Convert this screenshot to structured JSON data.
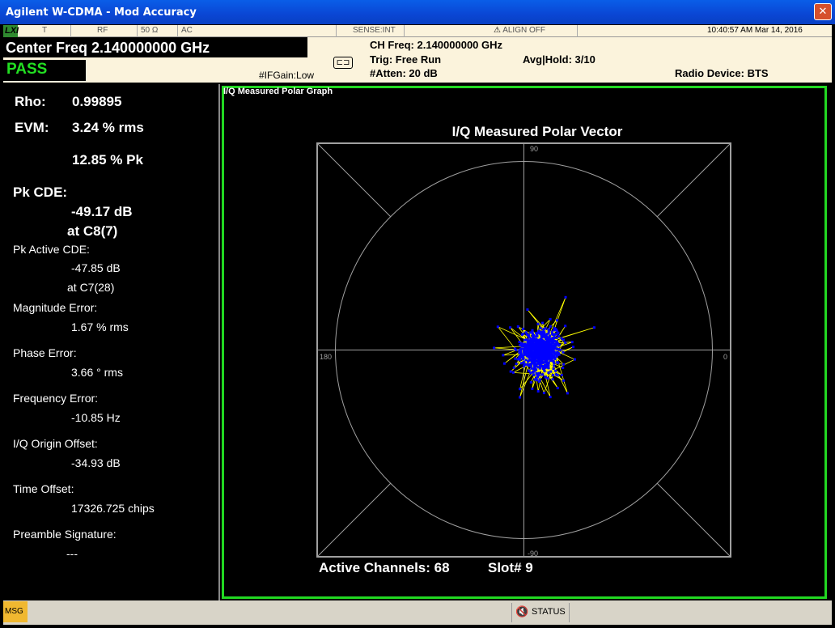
{
  "window": {
    "title": "Agilent W-CDMA - Mod Accuracy",
    "close_glyph": "✕"
  },
  "status_row": {
    "lxi": "LXI",
    "trigger": "T",
    "rf": "RF",
    "impedance": "50 Ω",
    "coupling": "AC",
    "sense": "SENSE:INT",
    "align": "ALIGN OFF",
    "datetime": "10:40:57 AM Mar 14, 2016"
  },
  "header": {
    "center_freq": "Center Freq 2.140000000 GHz",
    "pass_label": "PASS",
    "ifgain": "#IFGain:Low",
    "ch_freq": "CH Freq: 2.140000000 GHz",
    "trig": "Trig: Free Run",
    "atten": "#Atten: 20 dB",
    "avg_hold": "Avg|Hold: 3/10",
    "radio_device": "Radio Device: BTS"
  },
  "results": {
    "rho_label": "Rho:",
    "rho_value": "0.99895",
    "evm_label": "EVM:",
    "evm_rms": "3.24 % rms",
    "evm_pk": "12.85 % Pk",
    "pk_cde_label": "Pk CDE:",
    "pk_cde_value": "-49.17 dB",
    "pk_cde_at": "at C8(7)",
    "pk_active_cde_label": "Pk Active CDE:",
    "pk_active_cde_value": "-47.85 dB",
    "pk_active_cde_at": "at C7(28)",
    "mag_err_label": "Magnitude Error:",
    "mag_err_value": "1.67 % rms",
    "phase_err_label": "Phase Error:",
    "phase_err_value": "3.66 ° rms",
    "freq_err_label": "Frequency Error:",
    "freq_err_value": "-10.85 Hz",
    "iq_origin_label": "I/Q Origin Offset:",
    "iq_origin_value": "-34.93 dB",
    "time_offset_label": "Time Offset:",
    "time_offset_value": "17326.725 chips",
    "preamble_label": "Preamble Signature:",
    "preamble_value": "---"
  },
  "graph": {
    "window_label": "I/Q Measured Polar Graph",
    "title": "I/Q Measured Polar Vector",
    "angle_top": "90",
    "angle_left": "180",
    "angle_right": "0",
    "angle_bottom": "-90",
    "active_channels": "Active Channels: 68",
    "slot": "Slot# 9",
    "trace_color": "#ffff00",
    "point_color": "#0000ff",
    "grid_color": "#a0a0a0"
  },
  "bottom": {
    "msg": "MSG",
    "status": "STATUS"
  }
}
